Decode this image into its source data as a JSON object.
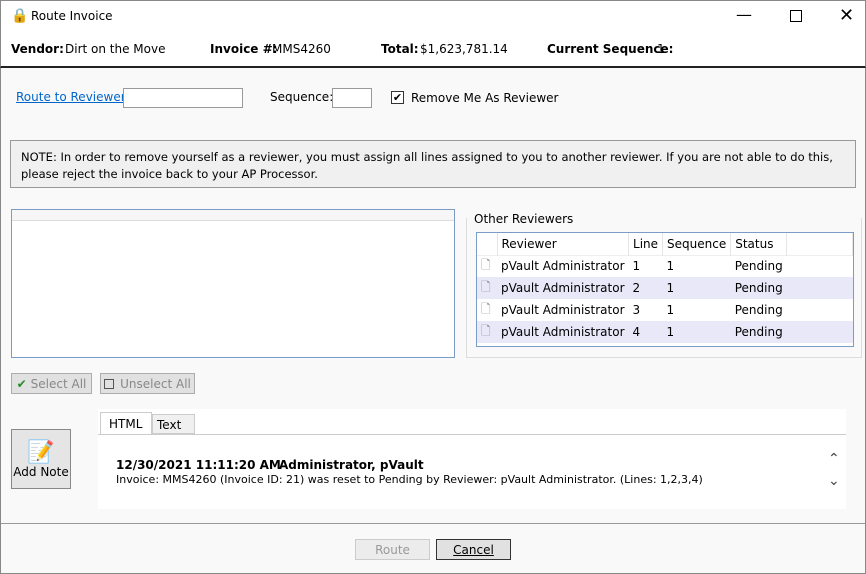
{
  "window": {
    "title": "Route Invoice",
    "icon": "lock-icon"
  },
  "header": {
    "vendor_label": "Vendor:",
    "vendor": "Dirt on the Move",
    "invoice_label": "Invoice #:",
    "invoice": "MMS4260",
    "total_label": "Total:",
    "total": "$1,623,781.14",
    "sequence_label": "Current Sequence:",
    "sequence": "1"
  },
  "route": {
    "link": "Route to Reviewer:",
    "reviewer_value": "",
    "sequence_label": "Sequence:",
    "sequence_value": "",
    "remove_me_label": "Remove Me As Reviewer",
    "remove_me_checked": true
  },
  "note": "NOTE: In order to remove yourself as a reviewer, you must assign all lines assigned to you to another reviewer. If you are not able to do this, please reject the invoice back to your AP Processor.",
  "other_reviewers": {
    "title": "Other Reviewers",
    "columns": [
      "Reviewer",
      "Line",
      "Sequence",
      "Status"
    ],
    "rows": [
      [
        "pVault Administrator",
        "1",
        "1",
        "Pending"
      ],
      [
        "pVault Administrator",
        "2",
        "1",
        "Pending"
      ],
      [
        "pVault Administrator",
        "3",
        "1",
        "Pending"
      ],
      [
        "pVault Administrator",
        "4",
        "1",
        "Pending"
      ]
    ]
  },
  "buttons": {
    "select_all": "Select All",
    "unselect_all": "Unselect All",
    "add_note": "Add Note",
    "route": "Route",
    "cancel": "Cancel"
  },
  "notes": {
    "tabs": [
      "HTML",
      "Text"
    ],
    "active_tab": "HTML",
    "entry": {
      "timestamp": "12/30/2021 11:11:20 AM",
      "author": "Administrator, pVault",
      "text": "Invoice: MMS4260 (Invoice ID: 21) was reset to Pending by Reviewer: pVault Administrator. (Lines: 1,2,3,4)"
    }
  }
}
